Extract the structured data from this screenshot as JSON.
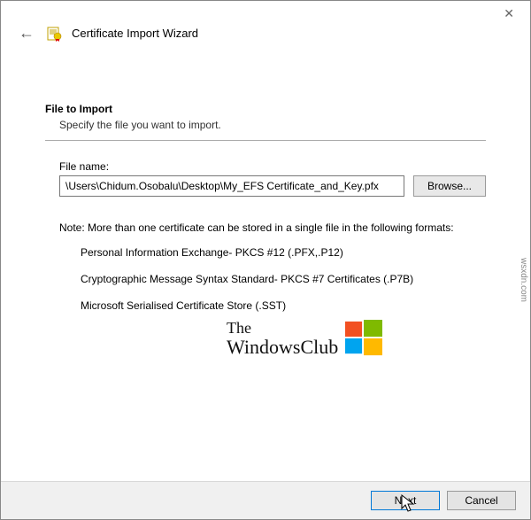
{
  "window": {
    "title": "Certificate Import Wizard"
  },
  "section": {
    "title": "File to Import",
    "subtitle": "Specify the file you want to import."
  },
  "fileField": {
    "label": "File name:",
    "value": "\\Users\\Chidum.Osobalu\\Desktop\\My_EFS Certificate_and_Key.pfx",
    "browse": "Browse..."
  },
  "note": {
    "lead": "Note:  More than one certificate can be stored in a single file in the following formats:",
    "items": [
      "Personal Information Exchange- PKCS #12 (.PFX,.P12)",
      "Cryptographic Message Syntax Standard- PKCS #7 Certificates (.P7B)",
      "Microsoft Serialised Certificate Store (.SST)"
    ]
  },
  "footer": {
    "next": "Next",
    "cancel": "Cancel"
  },
  "watermark": {
    "line1": "The",
    "line2": "WindowsClub"
  },
  "credit": "wsxdn.com"
}
